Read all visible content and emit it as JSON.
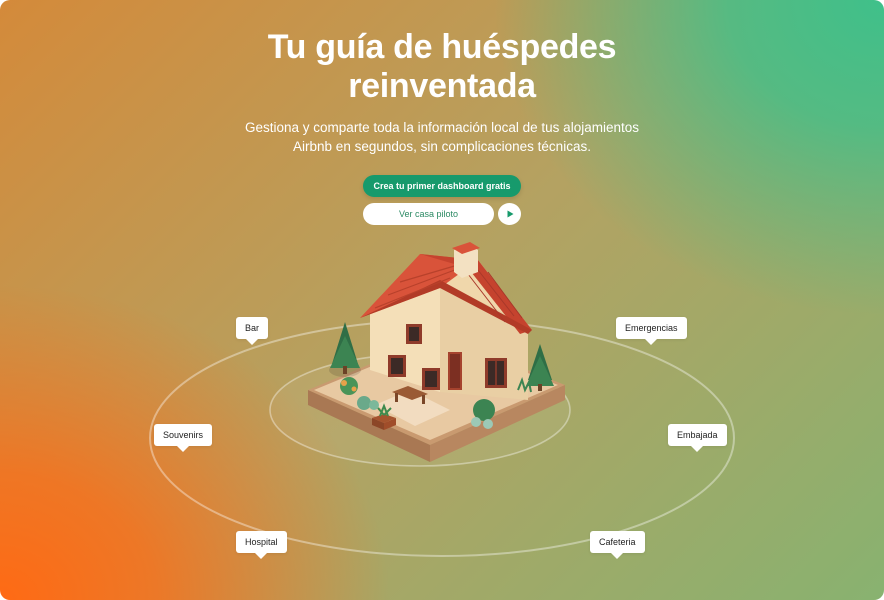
{
  "hero": {
    "title_line1": "Tu guía de huéspedes",
    "title_line2": "reinventada",
    "subtitle_line1": "Gestiona y comparte toda la información local de tus alojamientos",
    "subtitle_line2": "Airbnb en segundos, sin complicaciones técnicas."
  },
  "cta": {
    "primary_label": "Crea tu primer dashboard gratis",
    "secondary_label": "Ver casa piloto",
    "play_icon": "play-icon"
  },
  "places": [
    {
      "label": "Bar"
    },
    {
      "label": "Emergencias"
    },
    {
      "label": "Souvenirs"
    },
    {
      "label": "Embajada"
    },
    {
      "label": "Hospital"
    },
    {
      "label": "Cafeteria"
    }
  ],
  "colors": {
    "accent": "#179a6c",
    "gradient_bottom_left": "#ff6a14",
    "gradient_top_right": "#3fc08a",
    "roof": "#d9533a",
    "wall": "#f4dfb8"
  }
}
